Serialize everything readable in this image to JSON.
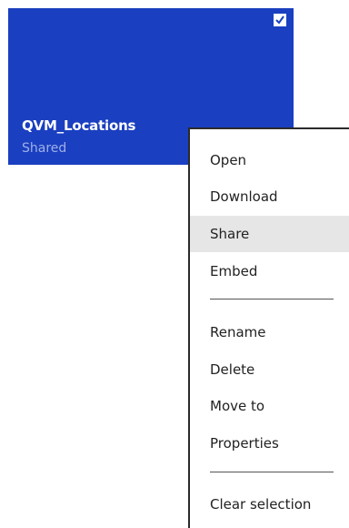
{
  "tile": {
    "title": "QVM_Locations",
    "subtitle": "Shared",
    "selected": true,
    "background_color": "#1a3fc0",
    "check_icon": "checkmark-icon"
  },
  "context_menu": {
    "highlighted_item": "Share",
    "groups": [
      [
        "Open",
        "Download",
        "Share",
        "Embed"
      ],
      [
        "Rename",
        "Delete",
        "Move to",
        "Properties"
      ],
      [
        "Clear selection"
      ]
    ],
    "items": {
      "open": "Open",
      "download": "Download",
      "share": "Share",
      "embed": "Embed",
      "rename": "Rename",
      "delete": "Delete",
      "move_to": "Move to",
      "properties": "Properties",
      "clear_selection": "Clear selection"
    }
  }
}
